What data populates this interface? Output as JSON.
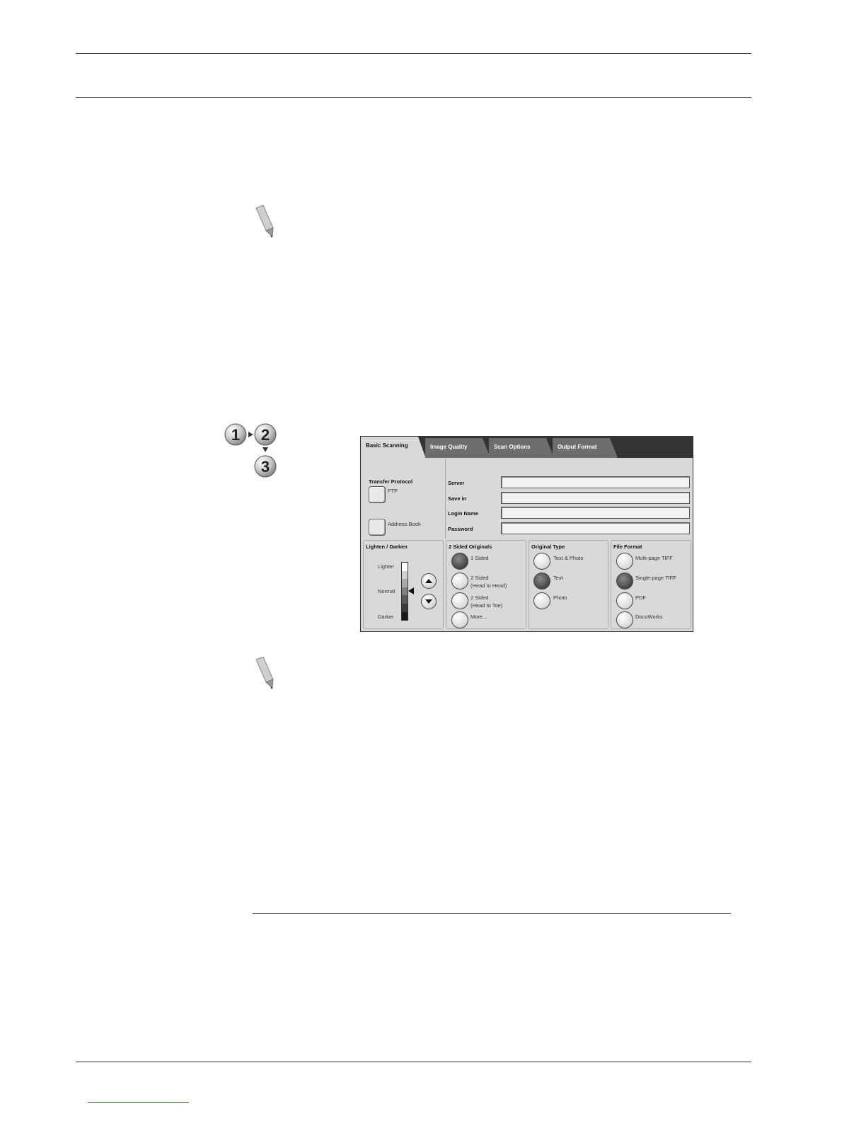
{
  "panel": {
    "tabs": [
      {
        "label": "Basic Scanning"
      },
      {
        "label": "Image Quality"
      },
      {
        "label": "Scan Options"
      },
      {
        "label": "Output Format"
      }
    ],
    "transfer": {
      "title": "Transfer Protocol",
      "ftp_label": "FTP",
      "address_book_label": "Address Book"
    },
    "fields": {
      "server": "Server",
      "save_in": "Save in",
      "login_name": "Login Name",
      "password": "Password"
    },
    "lighten": {
      "title": "Lighten / Darken",
      "lighter": "Lighter",
      "normal": "Normal",
      "darker": "Darker"
    },
    "sided": {
      "title": "2 Sided Originals",
      "opt1": "1 Sided",
      "opt2_line1": "2 Sided",
      "opt2_line2": "(Head to Head)",
      "opt3_line1": "2 Sided",
      "opt3_line2": "(Head to Toe)",
      "opt4": "More..."
    },
    "original_type": {
      "title": "Original Type",
      "opt1": "Text & Photo",
      "opt2": "Text",
      "opt3": "Photo"
    },
    "file_format": {
      "title": "File Format",
      "opt1": "Multi-page TIFF",
      "opt2": "Single-page TIFF",
      "opt3": "PDF",
      "opt4": "DocuWorks"
    }
  }
}
